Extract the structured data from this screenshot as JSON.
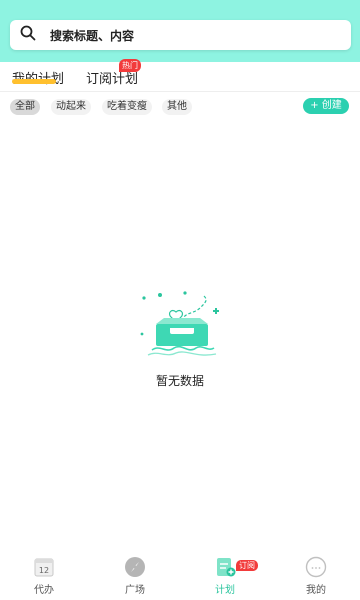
{
  "search": {
    "placeholder": "搜索标题、内容",
    "icon": "search-icon"
  },
  "tabs": [
    {
      "label": "我的计划",
      "active": true
    },
    {
      "label": "订阅计划",
      "badge": "热门"
    }
  ],
  "filters": {
    "chips": [
      {
        "label": "全部",
        "active": true
      },
      {
        "label": "动起来"
      },
      {
        "label": "吃着变瘦"
      },
      {
        "label": "其他"
      }
    ],
    "create_label": "+ 创建"
  },
  "empty_state": {
    "text": "暂无数据",
    "icon": "empty-box-icon"
  },
  "bottom_nav": {
    "items": [
      {
        "label": "代办",
        "icon": "calendar-icon",
        "calendar_day": "12"
      },
      {
        "label": "广场",
        "icon": "compass-icon"
      },
      {
        "label": "计划",
        "icon": "plan-icon",
        "active": true,
        "badge": "订阅"
      },
      {
        "label": "我的",
        "icon": "profile-icon"
      }
    ]
  },
  "colors": {
    "accent": "#2bd0b0",
    "header": "#8ef3e1",
    "badge": "#f23b3b",
    "tab_underline": "#ffc02e"
  }
}
